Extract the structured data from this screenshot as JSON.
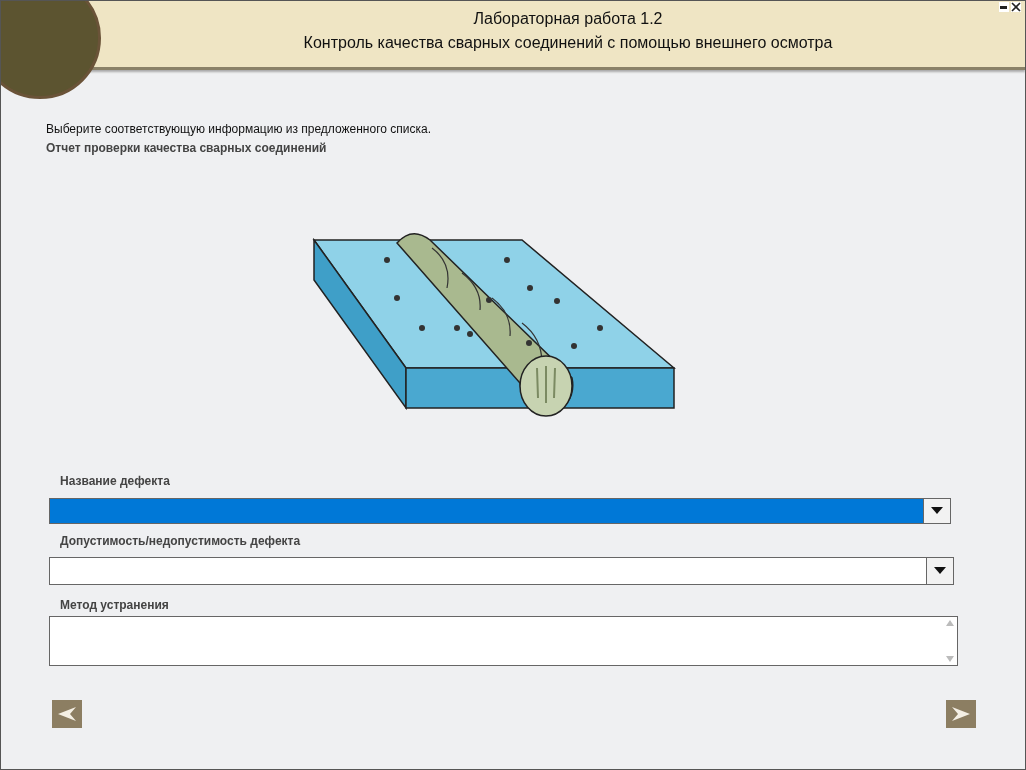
{
  "header": {
    "title": "Лабораторная работа 1.2",
    "subtitle": "Контроль качества сварных соединений с помощью внешнего осмотра"
  },
  "instruction": "Выберите соответствующую информацию из предложенного списка.",
  "report_title": "Отчет проверки качества сварных соединений",
  "fields": [
    {
      "kind": "dropdown",
      "label": "Название дефекта",
      "selected": true
    },
    {
      "kind": "dropdown",
      "label": "Допустимость/недопустимость дефекта",
      "selected": false
    },
    {
      "kind": "textarea",
      "label": "Метод устранения",
      "selected": false
    }
  ]
}
